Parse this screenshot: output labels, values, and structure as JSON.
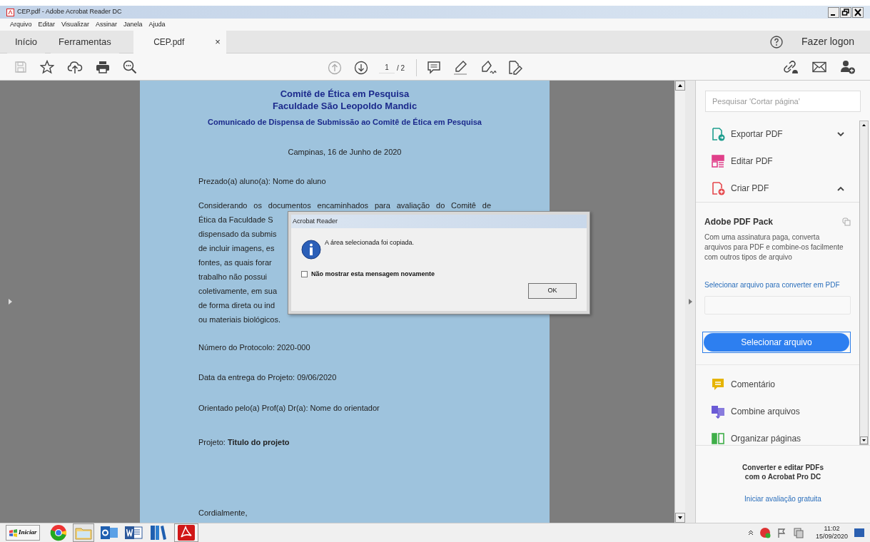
{
  "window": {
    "title": "CEP.pdf - Adobe Acrobat Reader DC"
  },
  "menu": [
    "Arquivo",
    "Editar",
    "Visualizar",
    "Assinar",
    "Janela",
    "Ajuda"
  ],
  "tabs": [
    {
      "label": "Início",
      "selected": false,
      "closable": false
    },
    {
      "label": "Ferramentas",
      "selected": false,
      "closable": false
    },
    {
      "label": "CEP.pdf",
      "selected": true,
      "closable": true
    }
  ],
  "tab_close": "×",
  "login": "Fazer logon",
  "toolbar": {
    "page": "1",
    "page_total": "/ 2"
  },
  "document": {
    "headings": [
      "Comitê de Ética em Pesquisa",
      "Faculdade São Leopoldo Mandic"
    ],
    "subtitle": "Comunicado de Dispensa de Submissão ao Comitê de Ética em Pesquisa",
    "date": "Campinas, 16 de Junho de 2020",
    "greeting": "Prezado(a) aluno(a): Nome do aluno",
    "paragraph_lines": [
      "Considerando os documentos encaminhados para avaliação do Comitê de",
      "Ética da Faculdade S",
      "dispensado da submis",
      "de incluir imagens, es",
      "fontes, as quais forar",
      "trabalho não possui",
      "coletivamente, em sua",
      "de forma direta ou ind",
      "ou materiais biológicos."
    ],
    "fields": [
      "Número do Protocolo: 2020-000",
      "Data da entrega do Projeto: 09/06/2020",
      "Orientado pelo(a) Prof(a) Dr(a): Nome do orientador"
    ],
    "project": "Projeto: **Titulo do projeto**",
    "closing": "Cordialmente,"
  },
  "dialog": {
    "title": "Acrobat Reader",
    "message": "A área selecionada foi copiada.",
    "checkbox": {
      "label": "Não mostrar esta mensagem novamente",
      "checked": false
    },
    "button": "OK"
  },
  "panel": {
    "search_placeholder": "Pesquisar 'Cortar página'",
    "tools": [
      {
        "label": "Exportar PDF",
        "color": "#1f9e8f",
        "kind": "group",
        "expanded": false
      },
      {
        "label": "Editar PDF",
        "color": "#e0408a",
        "kind": "tool"
      },
      {
        "label": "Criar PDF",
        "color": "#e5484d",
        "kind": "group",
        "expanded": true
      }
    ],
    "pack": {
      "title": "Adobe PDF Pack",
      "description": "Com uma assinatura paga, converta arquivos para PDF e combine-os facilmente com outros tipos de arquivo",
      "link": "Selecionar arquivo para converter em PDF",
      "button": "Selecionar arquivo"
    },
    "more_tools": [
      {
        "label": "Comentário",
        "color": "#e6b400"
      },
      {
        "label": "Combine arquivos",
        "color": "#6b5bd6"
      },
      {
        "label": "Organizar páginas",
        "color": "#3fae49"
      }
    ],
    "promo": [
      "Converter e editar PDFs",
      "com o Acrobat Pro DC"
    ],
    "promo_link": "Iniciar avaliação gratuita"
  },
  "taskbar": {
    "start": "Iniciar",
    "time": "11:02",
    "date": "15/09/2020"
  }
}
